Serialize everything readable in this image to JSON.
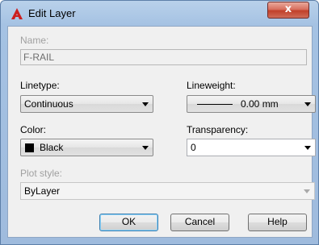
{
  "window": {
    "title": "Edit Layer",
    "close_glyph": "x"
  },
  "fields": {
    "name_label": "Name:",
    "name_value": "F-RAIL",
    "linetype_label": "Linetype:",
    "linetype_value": "Continuous",
    "lineweight_label": "Lineweight:",
    "lineweight_value": "0.00 mm",
    "color_label": "Color:",
    "color_value": "Black",
    "color_swatch": "#000000",
    "transparency_label": "Transparency:",
    "transparency_value": "0",
    "plot_style_label": "Plot style:",
    "plot_style_value": "ByLayer"
  },
  "buttons": {
    "ok": "OK",
    "cancel": "Cancel",
    "help": "Help"
  },
  "icons": {
    "app": "autocad-a-icon",
    "dropdown": "chevron-down-icon"
  }
}
